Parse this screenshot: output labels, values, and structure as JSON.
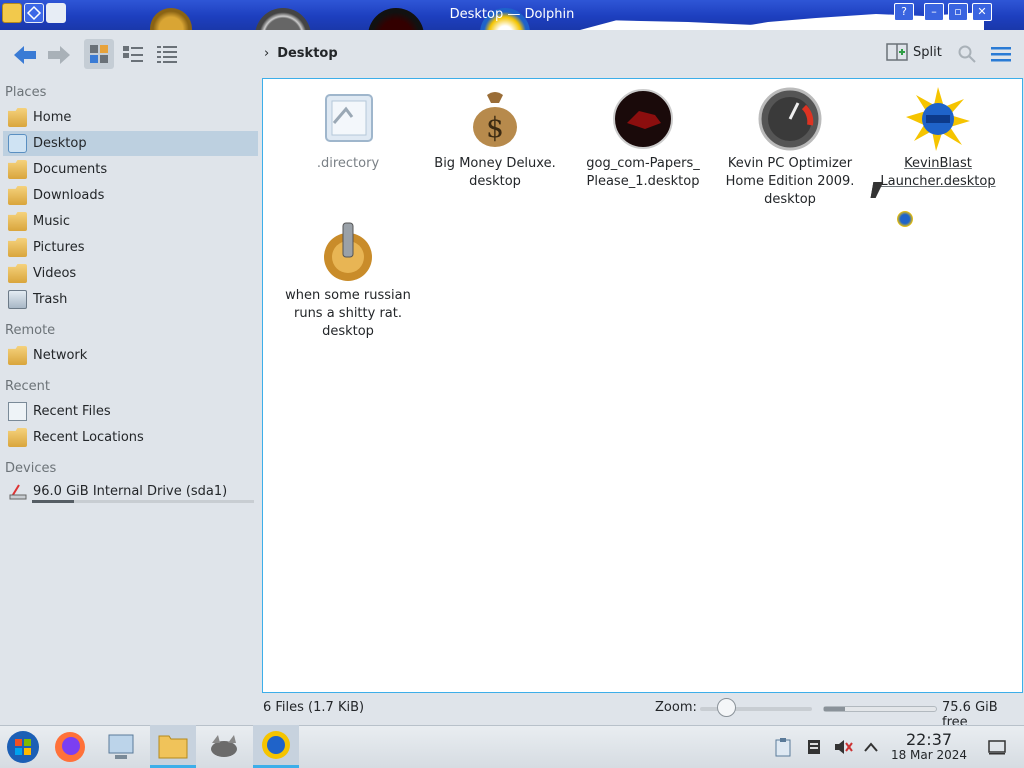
{
  "window": {
    "title": "Desktop — Dolphin"
  },
  "toolbar": {
    "back_icon": "arrow-left-icon",
    "forward_icon": "arrow-right-icon",
    "view_modes": [
      "icons-view",
      "compact-view",
      "details-view"
    ],
    "breadcrumb": "Desktop",
    "split_label": "Split",
    "search_icon": "search-icon",
    "menu_icon": "hamburger-menu-icon"
  },
  "sidebar": {
    "places_title": "Places",
    "places": [
      {
        "label": "Home",
        "icon": "home-folder-icon"
      },
      {
        "label": "Desktop",
        "icon": "desktop-icon",
        "active": true
      },
      {
        "label": "Documents",
        "icon": "documents-folder-icon"
      },
      {
        "label": "Downloads",
        "icon": "downloads-folder-icon"
      },
      {
        "label": "Music",
        "icon": "music-folder-icon"
      },
      {
        "label": "Pictures",
        "icon": "pictures-folder-icon"
      },
      {
        "label": "Videos",
        "icon": "videos-folder-icon"
      },
      {
        "label": "Trash",
        "icon": "trash-icon"
      }
    ],
    "remote_title": "Remote",
    "remote": [
      {
        "label": "Network",
        "icon": "network-folder-icon"
      }
    ],
    "recent_title": "Recent",
    "recent": [
      {
        "label": "Recent Files",
        "icon": "recent-files-icon"
      },
      {
        "label": "Recent Locations",
        "icon": "recent-locations-icon"
      }
    ],
    "devices_title": "Devices",
    "devices": [
      {
        "label": "96.0 GiB Internal Drive (sda1)",
        "icon": "drive-icon",
        "usage_fraction": 0.19
      }
    ]
  },
  "files": [
    {
      "label": ".directory",
      "icon": "directory-config-icon"
    },
    {
      "label": "Big Money Deluxe.\ndesktop",
      "icon": "money-bag-icon"
    },
    {
      "label": "gog_com-Papers_\nPlease_1.desktop",
      "icon": "papers-please-icon"
    },
    {
      "label": "Kevin PC Optimizer\nHome Edition 2009.\ndesktop",
      "icon": "speedometer-icon"
    },
    {
      "label": "KevinBlast\nLauncher.desktop",
      "icon": "globe-burst-icon"
    },
    {
      "label": "when some russian\nruns a shitty rat.\ndesktop",
      "icon": "gear-icon"
    }
  ],
  "status": {
    "summary": "6 Files (1.7 KiB)",
    "zoom_label": "Zoom:",
    "zoom_fraction": 0.24,
    "free_space": "75.6 GiB free",
    "used_fraction": 0.19
  },
  "taskbar": {
    "apps": [
      "start-orb-icon",
      "firefox-icon",
      "system-settings-icon",
      "dolphin-file-manager-icon",
      "gimp-icon",
      "kevinblast-icon"
    ],
    "tray": [
      "clipboard-icon",
      "storage-icon",
      "volume-muted-icon",
      "chevron-up-icon"
    ],
    "time": "22:37",
    "date": "18 Mar 2024",
    "show_desktop_icon": "show-desktop-icon"
  }
}
